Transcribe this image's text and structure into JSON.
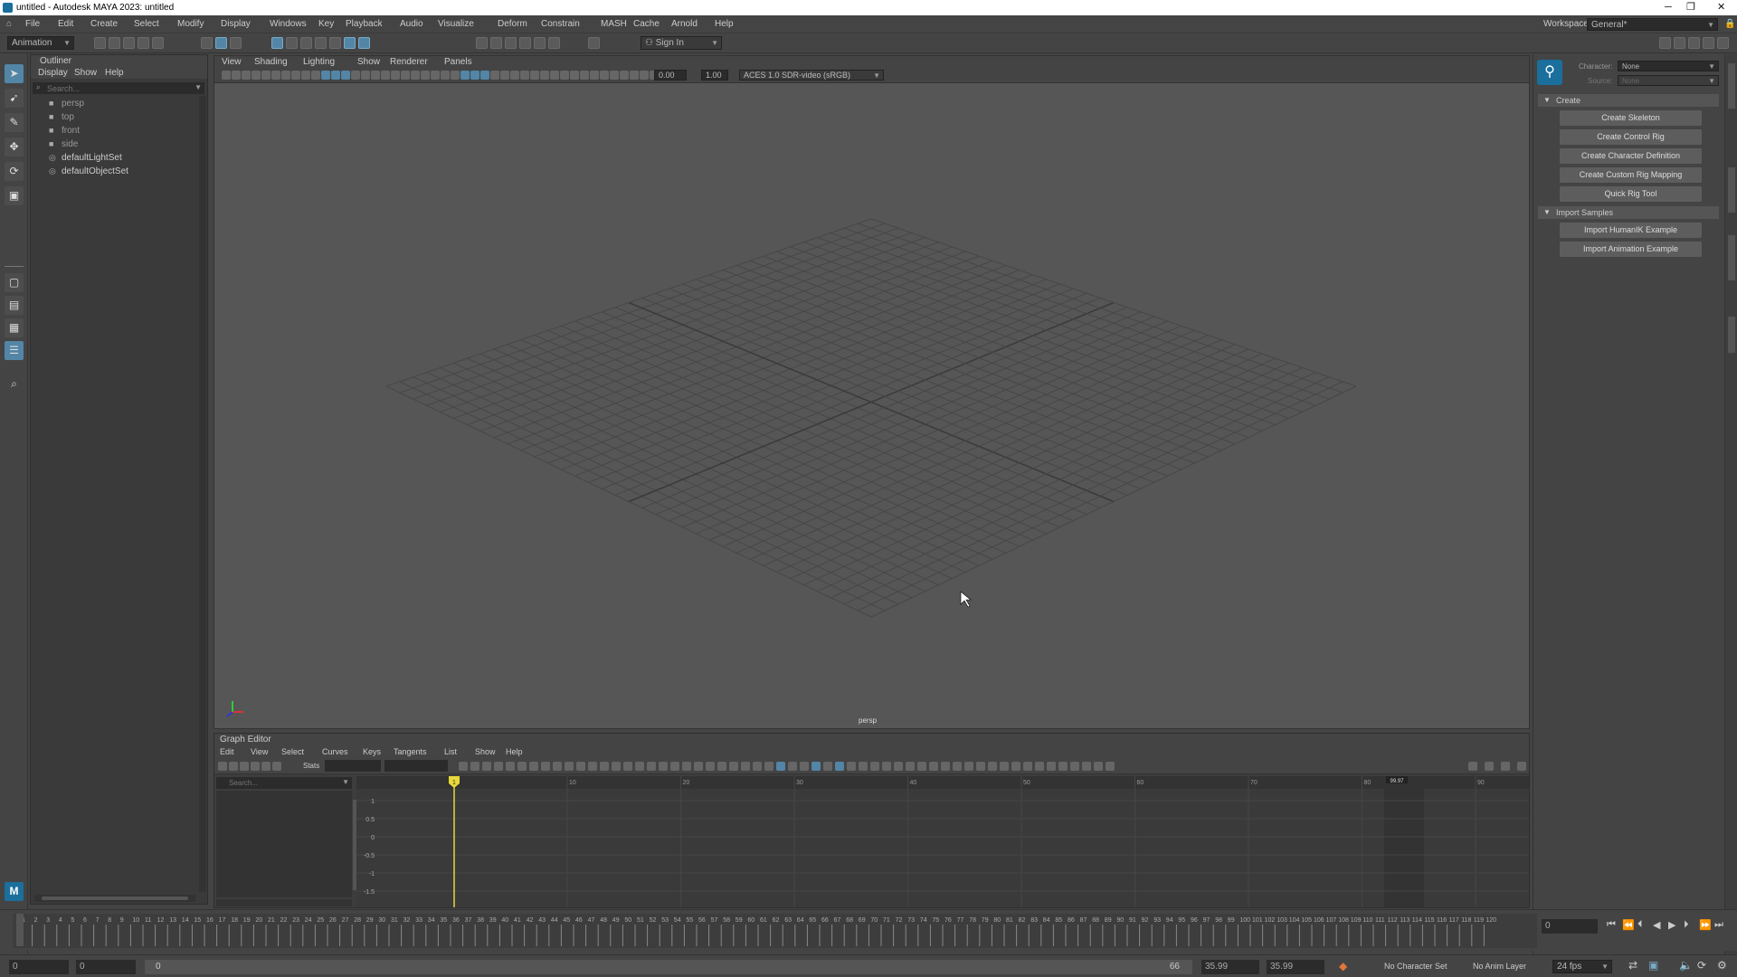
{
  "window": {
    "title": "untitled - Autodesk MAYA 2023: untitled"
  },
  "menubar": [
    "File",
    "Edit",
    "Create",
    "Select",
    "Modify",
    "Display",
    "Windows",
    "Key",
    "Playback",
    "Audio",
    "Visualize",
    "Deform",
    "Constrain",
    "MASH",
    "Cache",
    "Arnold",
    "Help"
  ],
  "workspace": {
    "label": "Workspace :",
    "value": "General*"
  },
  "toolbar": {
    "menuset": "Animation",
    "signin": "Sign In"
  },
  "outliner": {
    "title": "Outliner",
    "menu": [
      "Display",
      "Show",
      "Help"
    ],
    "search_placeholder": "Search...",
    "items": [
      {
        "name": "persp",
        "icon": "camera-icon"
      },
      {
        "name": "top",
        "icon": "camera-icon"
      },
      {
        "name": "front",
        "icon": "camera-icon"
      },
      {
        "name": "side",
        "icon": "camera-icon"
      },
      {
        "name": "defaultLightSet",
        "icon": "set-icon"
      },
      {
        "name": "defaultObjectSet",
        "icon": "set-icon"
      }
    ]
  },
  "viewport": {
    "menu": [
      "View",
      "Shading",
      "Lighting",
      "Show",
      "Renderer",
      "Panels"
    ],
    "field1": "0.00",
    "field2": "1.00",
    "colorspace": "ACES 1.0 SDR-video (sRGB)",
    "camera_label": "persp"
  },
  "graph_editor": {
    "title": "Graph Editor",
    "menu": [
      "Edit",
      "View",
      "Select",
      "Curves",
      "Keys",
      "Tangents",
      "List",
      "Show",
      "Help"
    ],
    "stats_label": "Stats",
    "search_placeholder": "Search...",
    "y_ticks": [
      "1",
      "0.5",
      "0",
      "-0.5",
      "-1",
      "-1.5"
    ],
    "x_ticks": [
      "10",
      "20",
      "30",
      "40",
      "50",
      "60",
      "70",
      "80",
      "90"
    ],
    "current_frame_marker": "1",
    "end_marker": "99.97"
  },
  "character_panel": {
    "character_label": "Character:",
    "character_value": "None",
    "source_label": "Source:",
    "source_value": "None",
    "sections": [
      {
        "title": "Create",
        "buttons": [
          "Create Skeleton",
          "Create Control Rig",
          "Create Character Definition",
          "Create Custom Rig Mapping",
          "Quick Rig Tool"
        ]
      },
      {
        "title": "Import Samples",
        "buttons": [
          "Import HumanIK Example",
          "Import Animation Example"
        ]
      }
    ]
  },
  "timeline": {
    "current_frame": "0",
    "range_start": "0",
    "range_inner_start": "0",
    "range_slider_start": "0",
    "range_slider_end": "66",
    "playback_end": "35.99",
    "anim_end": "35.99",
    "character_set": "No Character Set",
    "anim_layer": "No Anim Layer",
    "fps": "24 fps"
  },
  "colors": {
    "accent": "#5285a6",
    "playhead": "#e8d83a",
    "viewport": "#565656",
    "grid": "#474747"
  }
}
